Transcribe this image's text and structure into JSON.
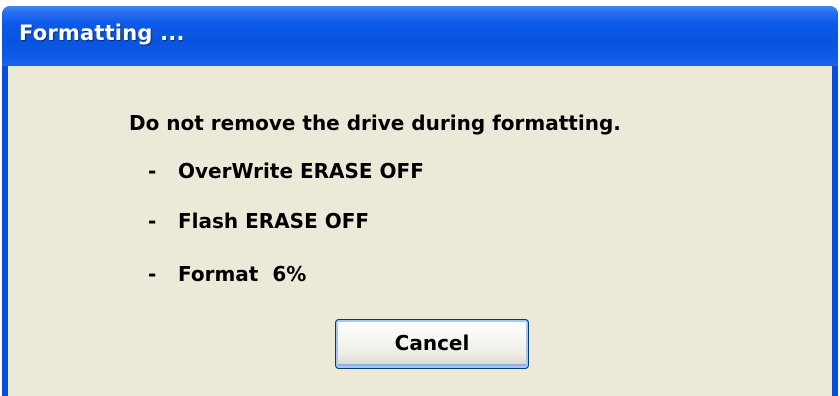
{
  "window": {
    "title": "Formatting ..."
  },
  "dialog": {
    "message": "Do not remove the drive during formatting.",
    "status": [
      {
        "dash": "-",
        "text": "OverWrite ERASE OFF"
      },
      {
        "dash": "-",
        "text": "Flash ERASE OFF"
      },
      {
        "dash": "-",
        "text": "Format",
        "value": "6%"
      }
    ],
    "progress_percent": 6
  },
  "buttons": {
    "cancel_label": "Cancel"
  },
  "colors": {
    "titlebar": "#0a53df",
    "dialog_background": "#ece9d8",
    "button_focus": "#a8c6f2"
  }
}
